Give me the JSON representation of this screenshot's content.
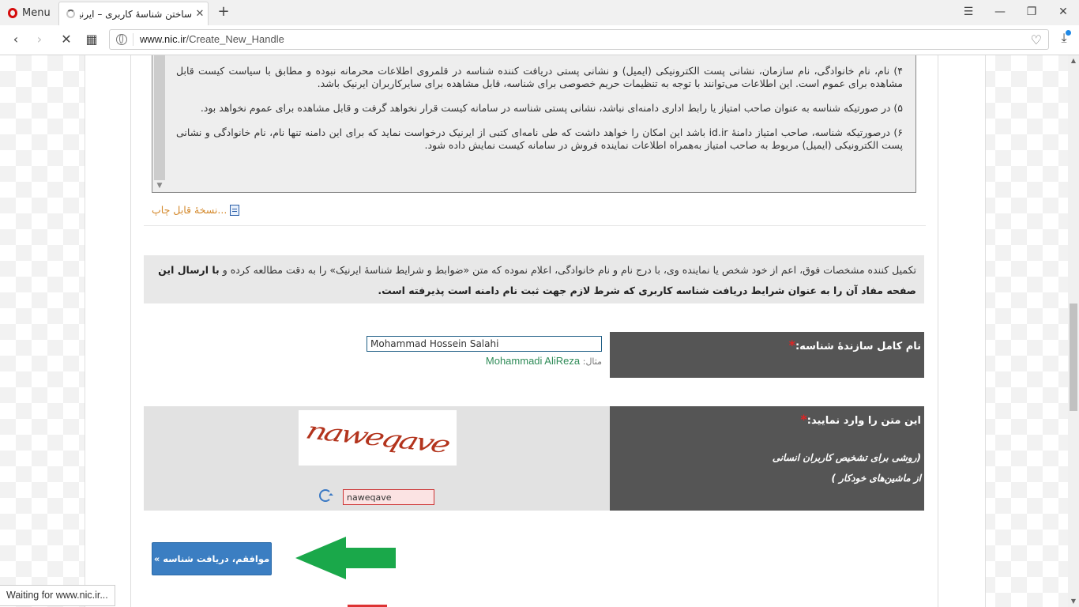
{
  "browser": {
    "menu_label": "Menu",
    "tab_title": "ساختن شناسهٔ کاربری – ایرنیک",
    "new_tab": "+",
    "url_domain": "www.nic.ir",
    "url_path": "/Create_New_Handle",
    "status_text": "Waiting for www.nic.ir..."
  },
  "terms": {
    "items": [
      "۴) نام، نام خانوادگی، نام سازمان، نشانی پست الکترونیکی (ایمیل) و نشانی پستی دریافت کننده شناسه در قلمروی اطلاعات محرمانه نبوده و مطابق با سیاست کیست قابل مشاهده برای عموم است. این اطلاعات می‌توانند با توجه به تنظیمات حریم خصوصی برای شناسه، قابل مشاهده برای سایرکاربران ایرنیک باشد.",
      "۵) در صورتیکه شناسه به عنوان صاحب امتیاز یا رابط اداری دامنه‌ای نباشد، نشانی پستی شناسه در سامانه کیست قرار نخواهد گرفت و قابل مشاهده برای عموم نخواهد بود.",
      "۶) درصورتیکه شناسه، صاحب امتیاز دامنهٔ id.ir باشد این امکان را خواهد داشت که طی نامه‌ای کتبی از ایرنیک درخواست نماید که برای این دامنه تنها نام، نام خانوادگی و نشانی پست الکترونیکی (ایمیل) مربوط به صاحب امتیاز به‌همراه اطلاعات نماینده فروش در سامانه کیست نمایش داده شود."
    ],
    "print_link": "نسخهٔ قابل چاپ..."
  },
  "agreement": {
    "text_normal": "تکمیل کننده مشخصات فوق، اعم از خود شخص یا نماینده وی، با درج نام و نام خانوادگی، اعلام نموده که متن «ضوابط و شرایط شناسهٔ ایرنیک» را به دقت مطالعه کرده و ",
    "text_bold": "با ارسال این صفحه مفاد آن را به عنوان شرایط دریافت شناسه کاربری که شرط لازم جهت ثبت نام دامنه است پذیرفته است."
  },
  "form": {
    "fullname_label": "نام کامل سازندهٔ شناسه:",
    "required_mark": "*",
    "fullname_value": "Mohammad Hossein Salahi",
    "example_label": "مثال:",
    "example_value": "Mohammadi AliReza",
    "captcha_label": "این متن را وارد نمایید:",
    "captcha_hint_line1": "(روشی برای تشخیص کاربران انسانی",
    "captcha_hint_line2": "از ماشین‌های خودکار )",
    "captcha_image_text": "naweqave",
    "captcha_value": "naweqave",
    "submit_label": "موافقم، دریافت شناسه »"
  },
  "colors": {
    "arrow": "#1aa84a",
    "label_bg": "#555555",
    "button_bg": "#3b7ec2"
  }
}
